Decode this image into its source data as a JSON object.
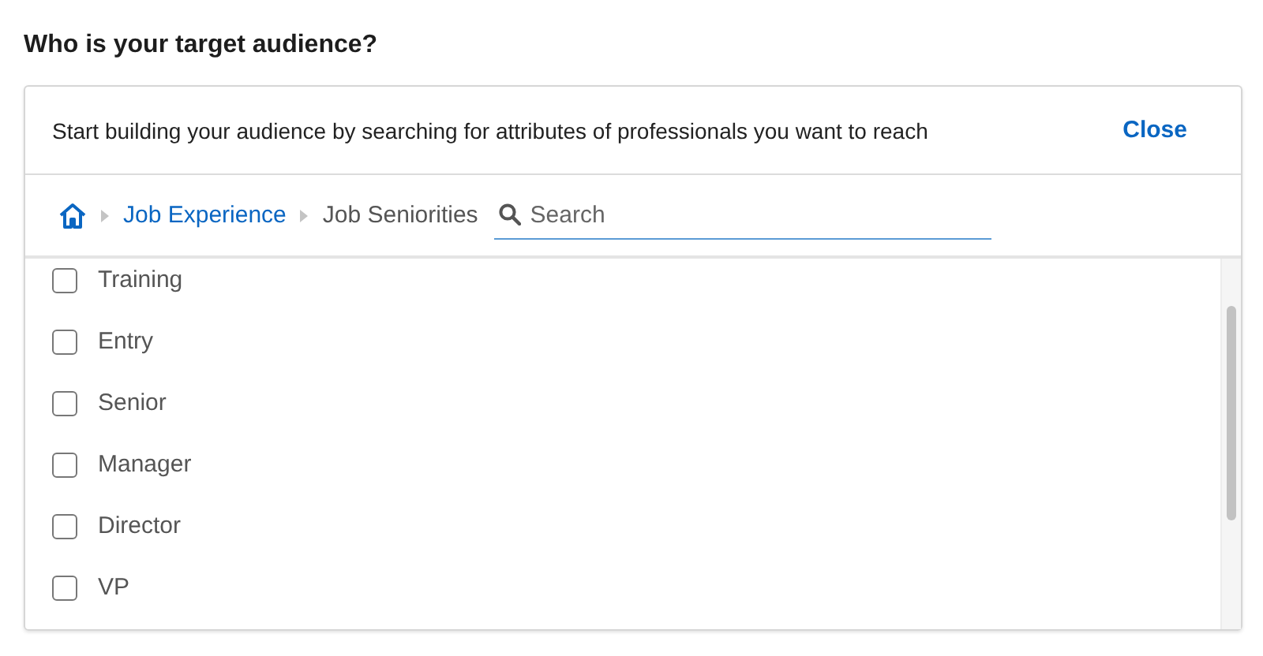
{
  "heading": "Who is your target audience?",
  "panel": {
    "intro": "Start building your audience by searching for attributes of professionals you want to reach",
    "close": "Close"
  },
  "breadcrumb": [
    {
      "label": "Job Experience",
      "link": true
    },
    {
      "label": "Job Seniorities",
      "link": false
    }
  ],
  "search": {
    "placeholder": "Search"
  },
  "options": [
    {
      "label": "Training",
      "checked": false
    },
    {
      "label": "Entry",
      "checked": false
    },
    {
      "label": "Senior",
      "checked": false
    },
    {
      "label": "Manager",
      "checked": false
    },
    {
      "label": "Director",
      "checked": false
    },
    {
      "label": "VP",
      "checked": false
    }
  ]
}
